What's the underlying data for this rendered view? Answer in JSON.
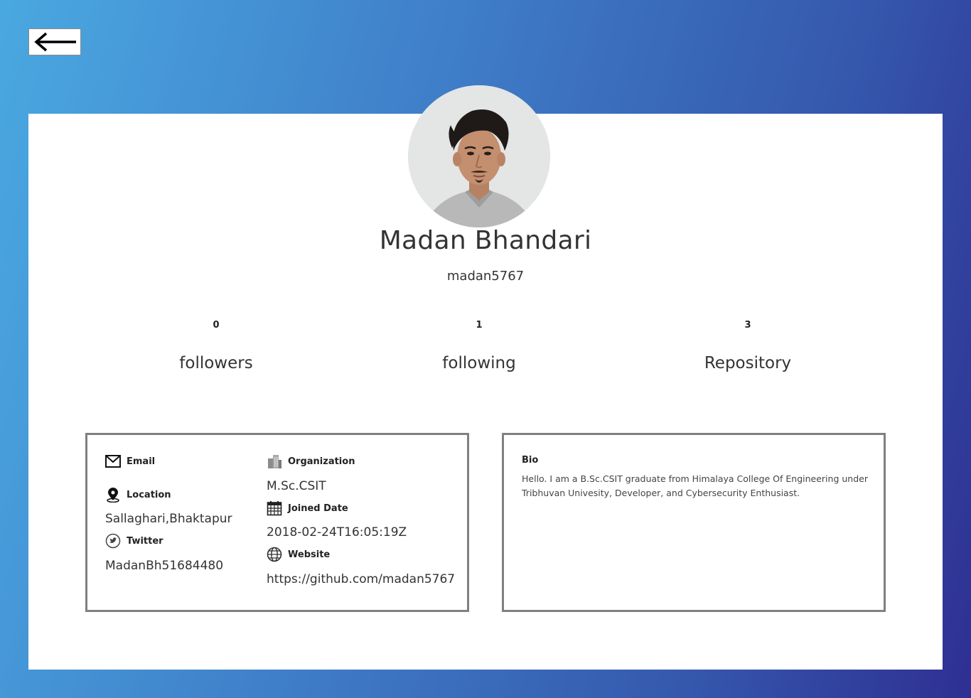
{
  "navigation": {
    "back_icon": "arrow-left-icon"
  },
  "profile": {
    "name": "Madan Bhandari",
    "username": "madan5767",
    "avatar_icon": "profile-photo"
  },
  "stats": {
    "followers": {
      "count": "0",
      "label": "followers"
    },
    "following": {
      "count": "1",
      "label": "following"
    },
    "repository": {
      "count": "3",
      "label": "Repository"
    }
  },
  "details": {
    "email": {
      "label": "Email",
      "value": "",
      "icon": "mail-icon"
    },
    "location": {
      "label": "Location",
      "value": "Sallaghari,Bhaktapur",
      "icon": "map-pin-icon"
    },
    "twitter": {
      "label": "Twitter",
      "value": "MadanBh51684480",
      "icon": "twitter-icon"
    },
    "organization": {
      "label": "Organization",
      "value": "M.Sc.CSIT",
      "icon": "building-icon"
    },
    "joined": {
      "label": "Joined Date",
      "value": "2018-02-24T16:05:19Z",
      "icon": "calendar-icon"
    },
    "website": {
      "label": "Website",
      "value": "https://github.com/madan5767",
      "icon": "globe-icon"
    }
  },
  "bio": {
    "title": "Bio",
    "text": "Hello. I am a B.Sc.CSIT graduate from Himalaya College Of Engineering under Tribhuvan Univesity, Developer, and Cybersecurity Enthusiast."
  },
  "colors": {
    "gradient_start": "#4aa8e0",
    "gradient_end": "#2e2f92",
    "card_background": "#ffffff",
    "box_border": "#808080"
  }
}
